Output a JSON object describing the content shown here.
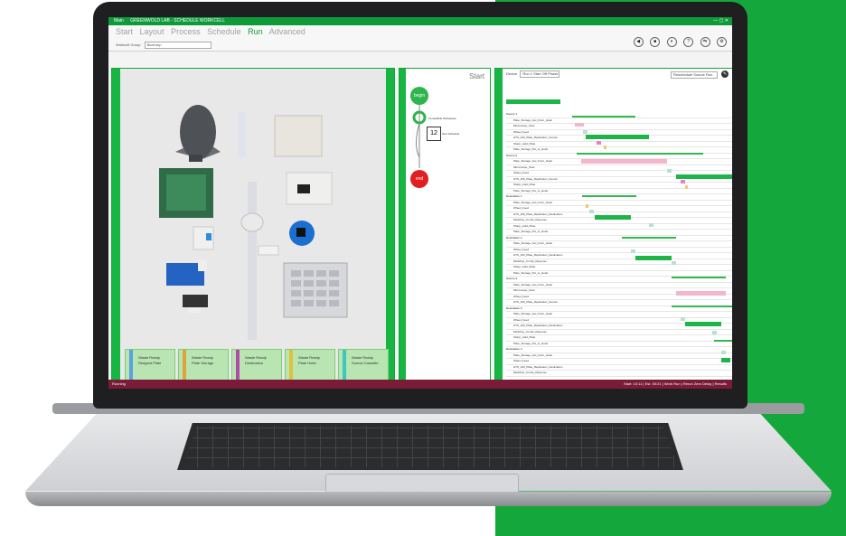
{
  "app": {
    "title_left": "Main",
    "title_center": "GREENWOLD LAB - SCHEDULE WORKCELL",
    "menus": [
      "Start",
      "Layout",
      "Process",
      "Schedule",
      "Run",
      "Advanced"
    ],
    "active_menu": "Run",
    "workcell_label": "Workcell Group",
    "workcell_value": "Biosharp",
    "controls": [
      "◀",
      "■",
      "⏸",
      "?",
      "⇆",
      "⚙"
    ]
  },
  "deck": {
    "slots": [
      {
        "title": "Waste  Ready",
        "name": "Reagent Plate",
        "color": "#5aa2e0"
      },
      {
        "title": "Waste  Ready",
        "name": "Plate Storage",
        "color": "#e0a23a"
      },
      {
        "title": "Waste  Ready",
        "name": "Destination",
        "color": "#b04aa8"
      },
      {
        "title": "Waste  Ready",
        "name": "Plate Hotel",
        "color": "#e0c23a"
      },
      {
        "title": "Waste  Ready",
        "name": "Source Cassette",
        "color": "#3ac8c0"
      }
    ]
  },
  "process": {
    "start_label": "Start",
    "begin_label": "begin",
    "end_label": "end",
    "step_label": "Compatible Workspace",
    "calendar_number": "12",
    "calendar_label": "New Schedule"
  },
  "schedule": {
    "toolbar_label": "Device",
    "dropdown1": "Run 1 Start Off Phase",
    "dropdown2": "Reschedule Source Run",
    "rows": [
      {
        "text": "Source 1",
        "type": "hdr"
      },
      {
        "text": "Plate_Storage_Get_From_Hotel",
        "type": "sub"
      },
      {
        "text": "Microscope_Scan",
        "type": "sub"
      },
      {
        "text": "Wheel_Feed",
        "type": "sub"
      },
      {
        "text": "HTS_100_Plate_Replication_Source",
        "type": "sub"
      },
      {
        "text": "Sharp_Hold_Plate",
        "type": "sub"
      },
      {
        "text": "Plate_Storage_Put_to_Hotel",
        "type": "sub"
      },
      {
        "text": "Source 2",
        "type": "hdr"
      },
      {
        "text": "Plate_Storage_Get_From_Hotel",
        "type": "sub"
      },
      {
        "text": "Microscope_Scan",
        "type": "sub"
      },
      {
        "text": "Wheel_Feed",
        "type": "sub"
      },
      {
        "text": "HTS_100_Plate_Replication_Source",
        "type": "sub"
      },
      {
        "text": "Sharp_Hold_Plate",
        "type": "sub"
      },
      {
        "text": "Plate_Storage_Put_to_Hotel",
        "type": "sub"
      },
      {
        "text": "Destination 1",
        "type": "hdr"
      },
      {
        "text": "Plate_Storage_Get_From_Hotel",
        "type": "sub"
      },
      {
        "text": "Wheel_Feed",
        "type": "sub"
      },
      {
        "text": "HTS_100_Plate_Replication_Destination",
        "type": "sub"
      },
      {
        "text": "Multidrop_Combi_Dispense",
        "type": "sub"
      },
      {
        "text": "Sharp_Hold_Plate",
        "type": "sub"
      },
      {
        "text": "Plate_Storage_Put_to_Hotel",
        "type": "sub"
      },
      {
        "text": "Destination 2",
        "type": "hdr"
      },
      {
        "text": "Plate_Storage_Get_From_Hotel",
        "type": "sub"
      },
      {
        "text": "Wheel_Feed",
        "type": "sub"
      },
      {
        "text": "HTS_100_Plate_Replication_Destination",
        "type": "sub"
      },
      {
        "text": "Multidrop_Combi_Dispense",
        "type": "sub"
      },
      {
        "text": "Sharp_Hold_Plate",
        "type": "sub"
      },
      {
        "text": "Plate_Storage_Put_to_Hotel",
        "type": "sub"
      },
      {
        "text": "Source 3",
        "type": "hdr"
      },
      {
        "text": "Plate_Storage_Get_From_Hotel",
        "type": "sub"
      },
      {
        "text": "Microscope_Scan",
        "type": "sub"
      },
      {
        "text": "Wheel_Feed",
        "type": "sub"
      },
      {
        "text": "HTS_100_Plate_Replication_Source",
        "type": "sub"
      },
      {
        "text": "Destination 3",
        "type": "hdr"
      },
      {
        "text": "Plate_Storage_Get_From_Hotel",
        "type": "sub"
      },
      {
        "text": "Wheel_Feed",
        "type": "sub"
      },
      {
        "text": "HTS_100_Plate_Replication_Destination",
        "type": "sub"
      },
      {
        "text": "Multidrop_Combi_Dispense",
        "type": "sub"
      },
      {
        "text": "Sharp_Hold_Plate",
        "type": "sub"
      },
      {
        "text": "Plate_Storage_Put_to_Hotel",
        "type": "sub"
      },
      {
        "text": "Destination 4",
        "type": "hdr"
      },
      {
        "text": "Plate_Storage_Get_From_Hotel",
        "type": "sub"
      },
      {
        "text": "Wheel_Feed",
        "type": "sub"
      },
      {
        "text": "HTS_100_Plate_Replication_Destination",
        "type": "sub"
      },
      {
        "text": "Multidrop_Combi_Dispense",
        "type": "sub"
      }
    ]
  },
  "status": {
    "left": "Running",
    "right": "Start: 10:11 | Est. 00:21 | Work Run | Rerun Zero Delay | Results"
  }
}
